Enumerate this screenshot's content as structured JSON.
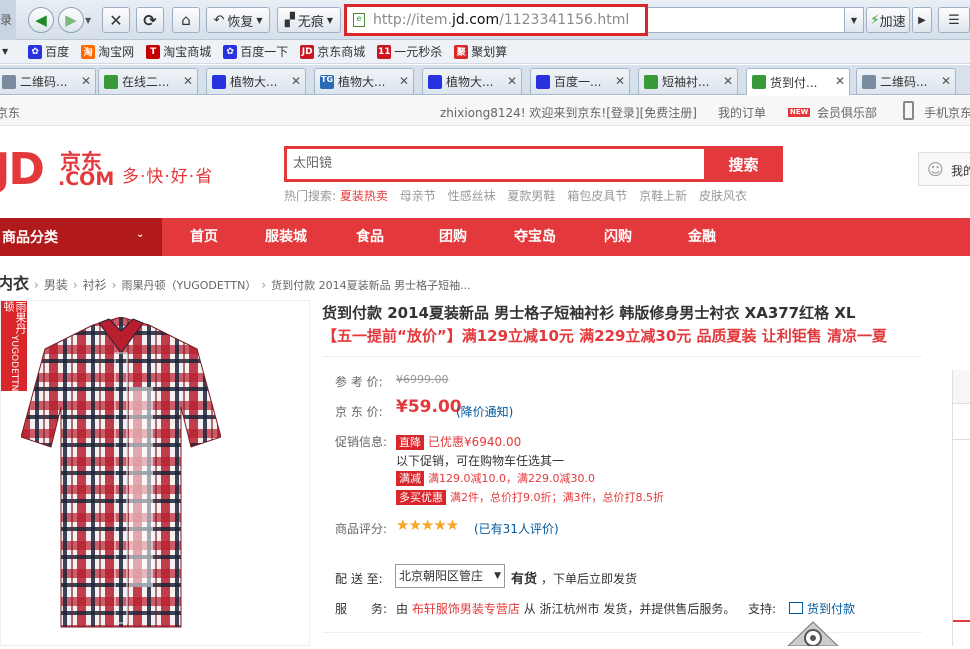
{
  "browser": {
    "back_icon": "arrow-left-icon",
    "forward_icon": "arrow-right-icon",
    "restore_label": "恢复",
    "incognito_label": "无痕",
    "url_prefix": "http://item.",
    "url_domain": "jd.com",
    "url_path": "/1123341156.html",
    "accelerate_label": "加速",
    "side_label": "录"
  },
  "bookmarks": [
    "百度",
    "淘宝网",
    "淘宝商城",
    "百度一下",
    "京东商城",
    "一元秒杀",
    "聚划算"
  ],
  "tabs": [
    "二维码...",
    "在线二...",
    "植物大...",
    "植物大...",
    "植物大...",
    "百度一...",
    "短袖衬...",
    "货到付...",
    "二维码..."
  ],
  "site_top": {
    "left": "京东",
    "user": "zhixiong8124!",
    "welcome": "欢迎来到京东!",
    "login": "[登录]",
    "register": "[免费注册]",
    "orders": "我的订单",
    "new_badge": "NEW",
    "club": "会员俱乐部",
    "mobile": "手机京东"
  },
  "header": {
    "logo_main": "JD",
    "logo_cn": "京东",
    "logo_com": ".COM",
    "slogan": "多·快·好·省",
    "search_value": "太阳镜",
    "search_button": "搜索",
    "hot_label": "热门搜索:",
    "hot_items": [
      "夏装热卖",
      "母亲节",
      "性感丝袜",
      "夏款男鞋",
      "箱包皮具节",
      "京鞋上新",
      "皮肤风衣"
    ],
    "account": "我的"
  },
  "nav": {
    "category": "商品分类",
    "items": [
      "首页",
      "服装城",
      "食品",
      "团购",
      "夺宝岛",
      "闪购",
      "金融"
    ]
  },
  "breadcrumb": [
    "内衣",
    "男装",
    "衬衫",
    "雨果丹顿（YUGODETTN）",
    "货到付款 2014夏装新品 男士格子短袖..."
  ],
  "product": {
    "brand_label": "雨果丹顿",
    "brand_latin": "YUGODETTN",
    "title": "货到付款 2014夏装新品 男士格子短袖衬衫 韩版修身男士衬衣 XA377红格 XL",
    "promo_title": "【五一提前“放价”】满129立减10元 满229立减30元 品质夏装 让利钜售 清凉一夏",
    "ref_price_label": "参 考 价:",
    "ref_price": "¥6999.00",
    "jd_price_label": "京 东 价:",
    "jd_price": "¥59.00",
    "price_notice": "(降价通知)",
    "promo_label": "促销信息:",
    "promo_tag1": "直降",
    "promo_text1": "已优惠¥6940.00",
    "promo_text2": "以下促销，可在购物车任选其一",
    "promo_tag2": "满减",
    "promo_text3": "满129.0减10.0，满229.0减30.0",
    "promo_tag3": "多买优惠",
    "promo_text4": "满2件，总价打9.0折；满3件，总价打8.5折",
    "rating_label": "商品评分:",
    "stars": "★★★★★",
    "reviews": "(已有31人评价)",
    "ship_label": "配 送 至:",
    "ship_region": "北京朝阳区管庄",
    "stock": "有货",
    "stock_note": "，下单后立即发货",
    "service_label": "服　　务:",
    "service_by": "由",
    "shop": "布轩服饰男装专营店",
    "service_from": "从 浙江杭州市 发货，并提供售后服务。",
    "support_label": "支持:",
    "cod": "货到付款"
  },
  "colors": {
    "jd_red": "#e4393c",
    "dark_red": "#b1191a",
    "link_blue": "#005aa0"
  }
}
